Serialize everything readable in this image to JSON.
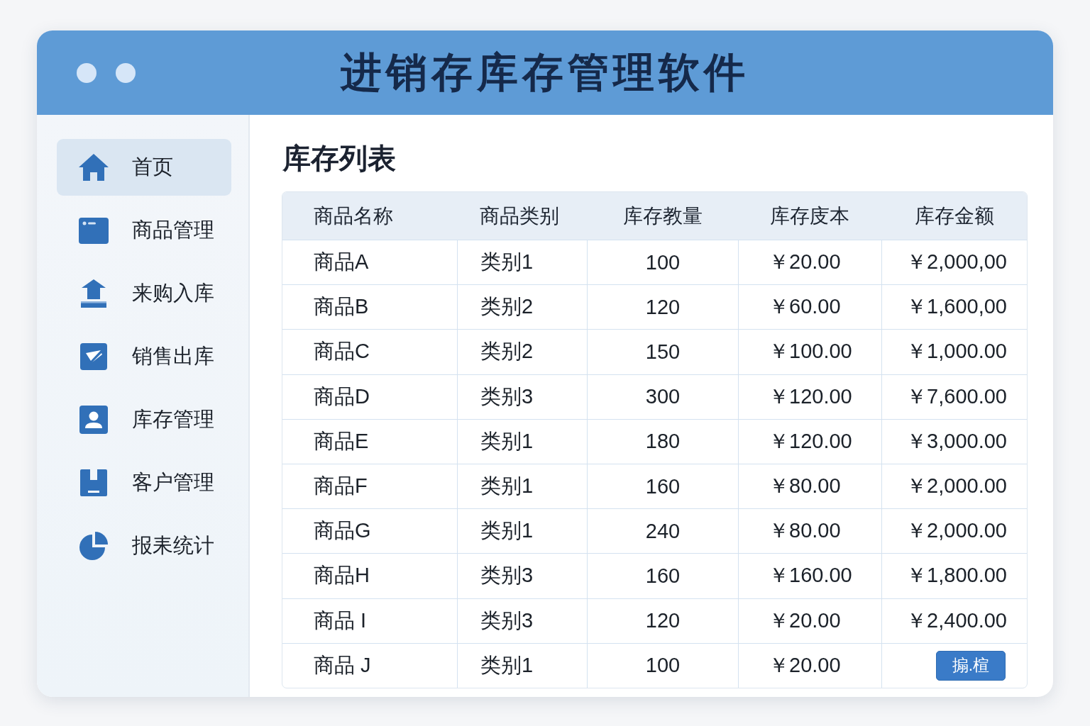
{
  "window": {
    "title": "进销存库存管理软件"
  },
  "sidebar": {
    "items": [
      {
        "label": "首页",
        "selected": true
      },
      {
        "label": "商品管理",
        "selected": false
      },
      {
        "label": "来购入库",
        "selected": false
      },
      {
        "label": "销售出库",
        "selected": false
      },
      {
        "label": "库存管理",
        "selected": false
      },
      {
        "label": "客户管理",
        "selected": false
      },
      {
        "label": "报耒统计",
        "selected": false
      }
    ]
  },
  "main": {
    "title": "库存列表",
    "table": {
      "columns": [
        "商品名称",
        "商品类别",
        "库存教量",
        "库存庋本",
        "库存金额"
      ],
      "rows": [
        {
          "name": "商品A",
          "category": "类别1",
          "quantity": "100",
          "cost": "￥20.00",
          "amount": "￥2,000,00"
        },
        {
          "name": "商品B",
          "category": "类别2",
          "quantity": "120",
          "cost": "￥60.00",
          "amount": "￥1,600,00"
        },
        {
          "name": "商品C",
          "category": "类别2",
          "quantity": "150",
          "cost": "￥100.00",
          "amount": "￥1,000.00"
        },
        {
          "name": "商品D",
          "category": "类别3",
          "quantity": "300",
          "cost": "￥120.00",
          "amount": "￥7,600.00"
        },
        {
          "name": "商品E",
          "category": "类别1",
          "quantity": "180",
          "cost": "￥120.00",
          "amount": "￥3,000.00"
        },
        {
          "name": "商品F",
          "category": "类别1",
          "quantity": "160",
          "cost": "￥80.00",
          "amount": "￥2,000.00"
        },
        {
          "name": "商品G",
          "category": "类别1",
          "quantity": "240",
          "cost": "￥80.00",
          "amount": "￥2,000.00"
        },
        {
          "name": "商品H",
          "category": "类别3",
          "quantity": "160",
          "cost": "￥160.00",
          "amount": "￥1,800.00"
        },
        {
          "name": "商品 I",
          "category": "类别3",
          "quantity": "120",
          "cost": "￥20.00",
          "amount": "￥2,400.00"
        },
        {
          "name": "商品 J",
          "category": "类别1",
          "quantity": "100",
          "cost": "￥20.00",
          "button": "搧.楦"
        }
      ]
    }
  }
}
